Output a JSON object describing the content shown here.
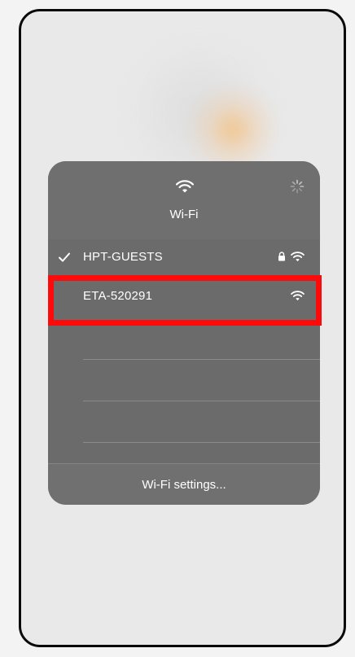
{
  "wifi_panel": {
    "title": "Wi-Fi",
    "header_icons": [
      "wifi-icon",
      "loading-spinner-icon"
    ],
    "networks": [
      {
        "name": "HPT-GUESTS",
        "connected": true,
        "secured": true,
        "icons": [
          "checkmark-icon",
          "lock-icon",
          "wifi-icon"
        ]
      },
      {
        "name": "ETA-520291",
        "connected": false,
        "secured": false,
        "highlighted": true,
        "icons": [
          "wifi-icon"
        ]
      }
    ],
    "footer": {
      "settings_label": "Wi-Fi settings..."
    }
  },
  "colors": {
    "panel_background": "#6b6b6b",
    "highlight_border": "#ff0a0a",
    "text": "#ffffff",
    "phone_frame": "#0a0a0a"
  }
}
